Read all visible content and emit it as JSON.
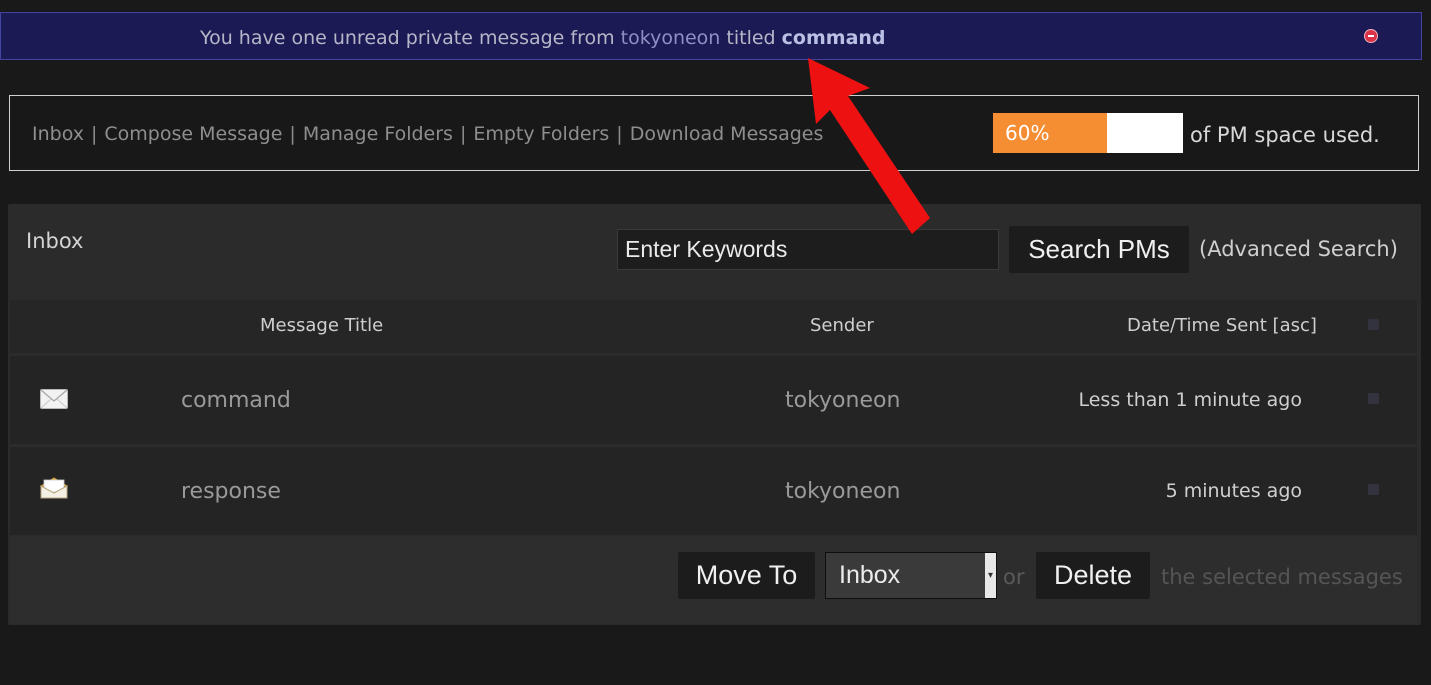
{
  "notice": {
    "prefix": "You have one unread private message from",
    "sender": "tokyoneon",
    "middle": "titled",
    "title": "command",
    "dismiss_icon": "dismiss-icon"
  },
  "nav": {
    "inbox": "Inbox",
    "compose": "Compose Message",
    "manage": "Manage Folders",
    "empty": "Empty Folders",
    "download": "Download Messages",
    "separator": "|"
  },
  "quota": {
    "percent_label": "60%",
    "percent": 60,
    "suffix": "of PM space used.",
    "fill_color": "#f58d32"
  },
  "panel": {
    "title": "Inbox",
    "search_placeholder": "Enter Keywords",
    "search_button": "Search PMs",
    "advanced": "(Advanced Search)"
  },
  "table": {
    "headers": {
      "title": "Message Title",
      "sender": "Sender",
      "date": "Date/Time Sent [asc]"
    },
    "rows": [
      {
        "icon": "envelope-closed-icon",
        "title": "command",
        "sender": "tokyoneon",
        "date": "Less than 1 minute ago"
      },
      {
        "icon": "envelope-open-icon",
        "title": "response",
        "sender": "tokyoneon",
        "date": "5 minutes ago"
      }
    ]
  },
  "actions": {
    "move_button": "Move To",
    "folder_selected": "Inbox",
    "or": "or",
    "delete_button": "Delete",
    "suffix": "the selected messages"
  },
  "colors": {
    "annotation_arrow": "#ee1111",
    "notice_bg": "#1c1a54"
  }
}
